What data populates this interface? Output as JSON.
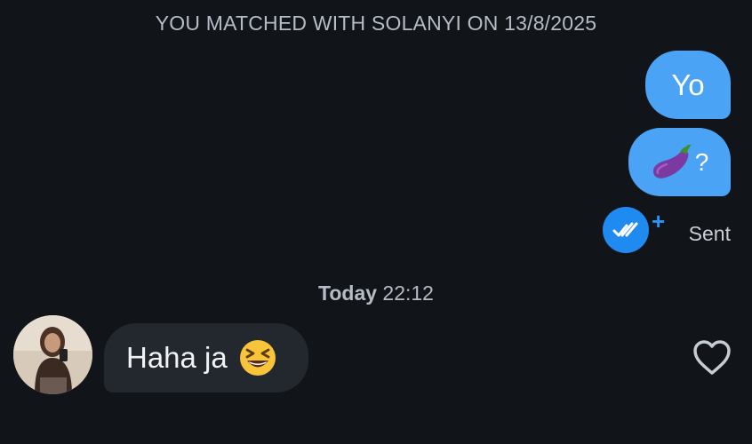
{
  "match_banner": "YOU MATCHED WITH SOLANYI ON 13/8/2025",
  "messages_out": [
    {
      "text": "Yo"
    },
    {
      "text": "?",
      "emoji": "eggplant-icon"
    }
  ],
  "status": {
    "label": "Sent",
    "icon": "double-check-icon",
    "extra": "+"
  },
  "divider": {
    "day": "Today",
    "time": "22:12"
  },
  "message_in": {
    "text": "Haha ja",
    "emoji": "grinning-squinting-face-icon"
  },
  "colors": {
    "background": "#111418",
    "outgoing_bubble": "#4aa3f5",
    "incoming_bubble": "#23272e",
    "read_badge": "#1f8bf0"
  }
}
